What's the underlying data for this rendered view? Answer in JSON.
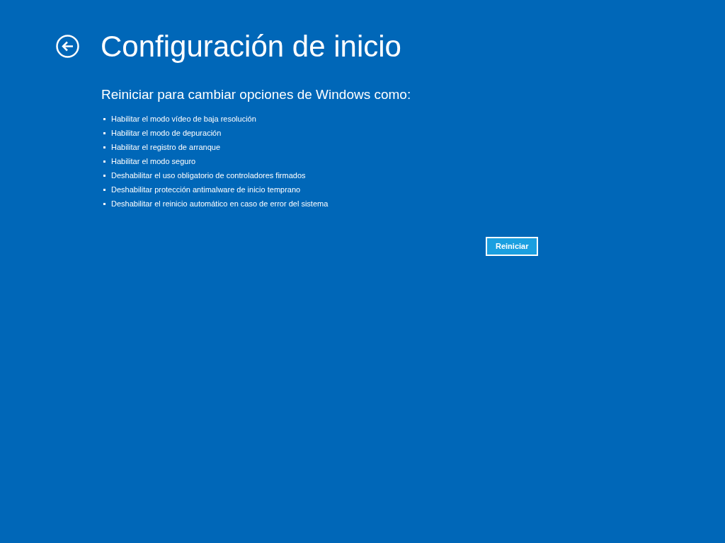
{
  "title": "Configuración de inicio",
  "subtitle": "Reiniciar para cambiar opciones de Windows como:",
  "options": [
    "Habilitar el modo vídeo de baja resolución",
    "Habilitar el modo de depuración",
    "Habilitar el registro de arranque",
    "Habilitar el modo seguro",
    "Deshabilitar el uso obligatorio de controladores firmados",
    "Deshabilitar protección antimalware de inicio temprano",
    "Deshabilitar el reinicio automático en caso de error del sistema"
  ],
  "button": "Reiniciar"
}
